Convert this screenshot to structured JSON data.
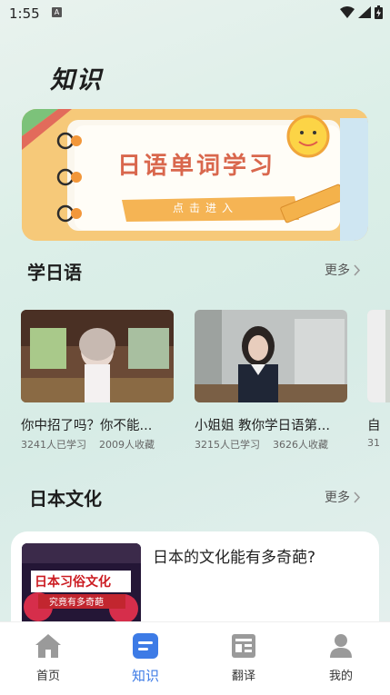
{
  "status": {
    "time": "1:55",
    "badge": "A"
  },
  "page_title": "知识",
  "banner": {
    "title": "日语单词学习",
    "cta": "点击进入"
  },
  "section_learn": {
    "title": "学日语",
    "more": "更多"
  },
  "videos": [
    {
      "title": "你中招了吗？你不能...",
      "learners": "3241人已学习",
      "favorites": "2009人收藏"
    },
    {
      "title": "小姐姐 教你学日语第...",
      "learners": "3215人已学习",
      "favorites": "3626人收藏"
    },
    {
      "title": "自",
      "learners": "31",
      "favorites": ""
    }
  ],
  "section_culture": {
    "title": "日本文化",
    "more": "更多"
  },
  "culture_card": {
    "title": "日本的文化能有多奇葩?",
    "thumb_text_1": "日本习俗文化",
    "thumb_text_2": "究竟有多奇葩"
  },
  "nav": [
    {
      "label": "首页",
      "icon": "home-icon"
    },
    {
      "label": "知识",
      "icon": "knowledge-icon"
    },
    {
      "label": "翻译",
      "icon": "translate-icon"
    },
    {
      "label": "我的",
      "icon": "profile-icon"
    }
  ],
  "colors": {
    "accent": "#3d7be6",
    "banner": "#f6c979",
    "banner_title": "#d9674d"
  }
}
